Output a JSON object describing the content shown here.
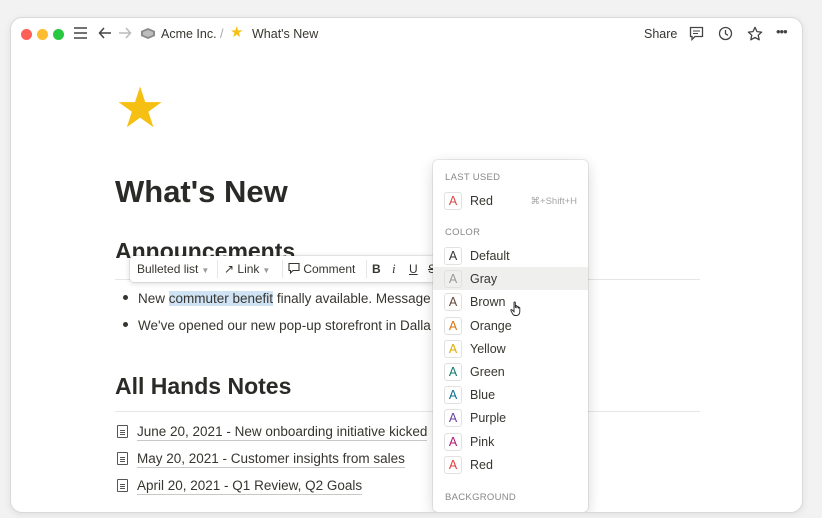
{
  "topbar": {
    "breadcrumb_workspace": "Acme Inc.",
    "breadcrumb_separator": "/",
    "breadcrumb_page": "What's New",
    "share_label": "Share",
    "more_glyph": "•••"
  },
  "page": {
    "icon": "★",
    "title": "What's New"
  },
  "announcements": {
    "heading": "Announcements",
    "bullet1_pre": "New ",
    "bullet1_highlight": "commuter benefit",
    "bullet1_post": " finally available. Message",
    "bullet2": "We've opened our new pop-up storefront in Dalla"
  },
  "all_hands": {
    "heading": "All Hands Notes",
    "links": [
      "June 20, 2021 - New onboarding initiative kicked",
      "May 20, 2021 - Customer insights from sales",
      "April 20, 2021 - Q1 Review, Q2 Goals"
    ]
  },
  "toolbar": {
    "block_type": "Bulleted list",
    "link_label": "Link",
    "comment_label": "Comment",
    "bold": "B",
    "italic": "i",
    "underline": "U",
    "strike": "S"
  },
  "color_menu": {
    "last_used_title": "LAST USED",
    "color_title": "COLOR",
    "background_title": "BACKGROUND",
    "glyph": "A",
    "last_used": {
      "label": "Red",
      "shortcut": "⌘+Shift+H",
      "color": "#d44c47"
    },
    "colors": [
      {
        "label": "Default",
        "color": "#37352f"
      },
      {
        "label": "Gray",
        "color": "#9b9a97"
      },
      {
        "label": "Brown",
        "color": "#64473a"
      },
      {
        "label": "Orange",
        "color": "#d9730d"
      },
      {
        "label": "Yellow",
        "color": "#dfab01"
      },
      {
        "label": "Green",
        "color": "#0f7b6c"
      },
      {
        "label": "Blue",
        "color": "#0b6e99"
      },
      {
        "label": "Purple",
        "color": "#6940a5"
      },
      {
        "label": "Pink",
        "color": "#ad1a72"
      },
      {
        "label": "Red",
        "color": "#e03e3e"
      }
    ],
    "hovered": "Gray"
  }
}
